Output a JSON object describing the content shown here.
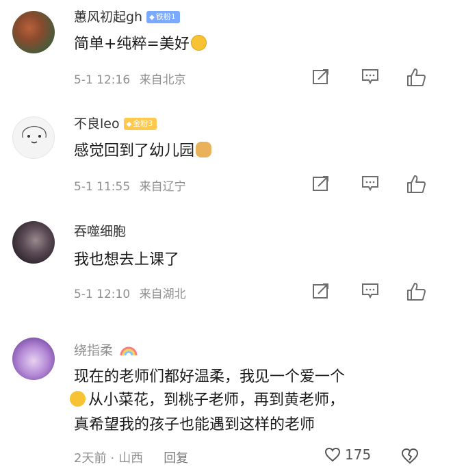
{
  "comments": [
    {
      "name": "蕙风初起gh",
      "badge": "铁粉1",
      "badge_color": "#7aa9ff",
      "text": "简单+纯粹=美好",
      "emoji": "smile-emoji",
      "date": "5-1 12:16",
      "location": "来自北京"
    },
    {
      "name": "不良leo",
      "badge": "金粉3",
      "badge_color": "#ffc94d",
      "text": "感觉回到了幼儿园",
      "emoji": "cat-emoji",
      "date": "5-1 11:55",
      "location": "来自辽宁"
    },
    {
      "name": "吞噬细胞",
      "text": "我也想去上课了",
      "date": "5-1 12:10",
      "location": "来自湖北"
    }
  ],
  "last_comment": {
    "name": "绕指柔",
    "lines": [
      "现在的老师们都好温柔，我见一个爱一个",
      "从小菜花，到桃子老师，再到黄老师，",
      "真希望我的孩子也能遇到这样的老师"
    ],
    "time": "2天前",
    "separator": "·",
    "location": "山西",
    "reply": "回复",
    "likes": "175"
  }
}
